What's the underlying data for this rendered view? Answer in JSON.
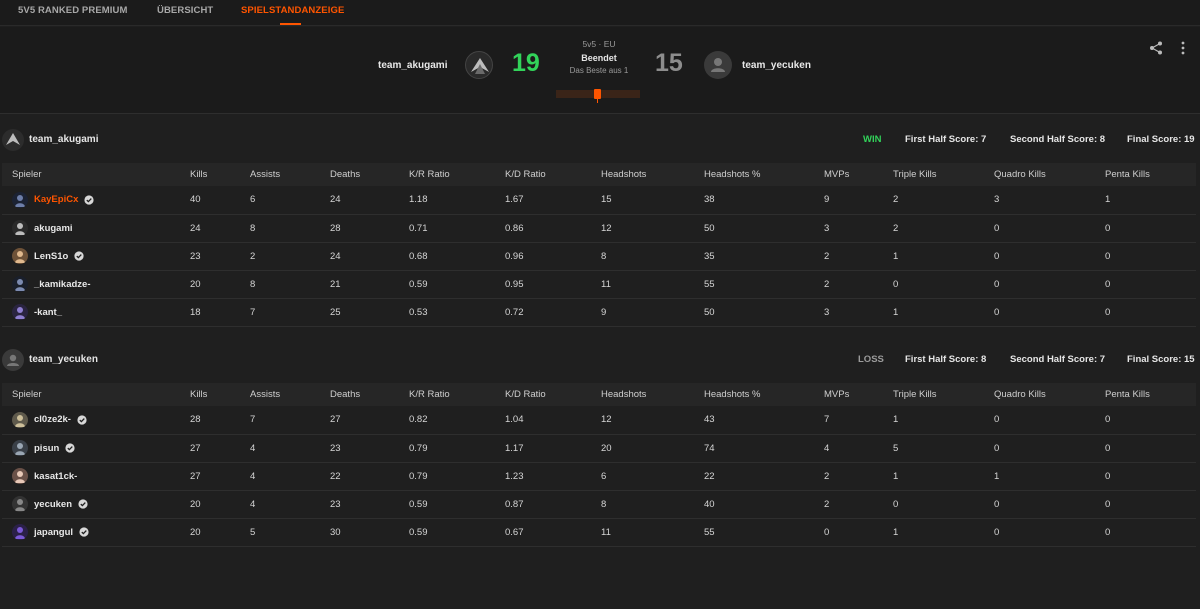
{
  "nav": {
    "tabs": [
      {
        "label": "5V5 RANKED PREMIUM"
      },
      {
        "label": "ÜBERSICHT"
      },
      {
        "label": "SPIELSTANDANZEIGE"
      }
    ]
  },
  "match": {
    "mode": "5v5 · EU",
    "status": "Beendet",
    "best_of": "Das Beste aus 1",
    "team1": {
      "name": "team_akugami",
      "score": "19"
    },
    "team2": {
      "name": "team_yecuken",
      "score": "15"
    }
  },
  "icons": {
    "share": "share-icon",
    "more": "more-vertical-icon",
    "verified": "verified-check-icon"
  },
  "colors": {
    "accent": "#ff5500",
    "win": "#32d35a",
    "loss_score": "#8d8d8d"
  },
  "columns": [
    "Spieler",
    "Kills",
    "Assists",
    "Deaths",
    "K/R Ratio",
    "K/D Ratio",
    "Headshots",
    "Headshots %",
    "MVPs",
    "Triple Kills",
    "Quadro Kills",
    "Penta Kills"
  ],
  "teams": [
    {
      "name": "team_akugami",
      "result": "WIN",
      "first_half": "First Half Score: 7",
      "second_half": "Second Half Score: 8",
      "final": "Final Score: 19",
      "players": [
        {
          "name": "KayEpiCx",
          "verified": true,
          "highlight": true,
          "stats": [
            "40",
            "6",
            "24",
            "1.18",
            "1.67",
            "15",
            "38",
            "9",
            "2",
            "3",
            "1"
          ]
        },
        {
          "name": "akugami",
          "verified": false,
          "highlight": false,
          "stats": [
            "24",
            "8",
            "28",
            "0.71",
            "0.86",
            "12",
            "50",
            "3",
            "2",
            "0",
            "0"
          ]
        },
        {
          "name": "LenS1o",
          "verified": true,
          "highlight": false,
          "stats": [
            "23",
            "2",
            "24",
            "0.68",
            "0.96",
            "8",
            "35",
            "2",
            "1",
            "0",
            "0"
          ]
        },
        {
          "name": "_kamikadze-",
          "verified": false,
          "highlight": false,
          "stats": [
            "20",
            "8",
            "21",
            "0.59",
            "0.95",
            "11",
            "55",
            "2",
            "0",
            "0",
            "0"
          ]
        },
        {
          "name": "-kant_",
          "verified": false,
          "highlight": false,
          "stats": [
            "18",
            "7",
            "25",
            "0.53",
            "0.72",
            "9",
            "50",
            "3",
            "1",
            "0",
            "0"
          ]
        }
      ]
    },
    {
      "name": "team_yecuken",
      "result": "LOSS",
      "first_half": "First Half Score: 8",
      "second_half": "Second Half Score: 7",
      "final": "Final Score: 15",
      "players": [
        {
          "name": "cl0ze2k-",
          "verified": true,
          "highlight": false,
          "stats": [
            "28",
            "7",
            "27",
            "0.82",
            "1.04",
            "12",
            "43",
            "7",
            "1",
            "0",
            "0"
          ]
        },
        {
          "name": "pisun",
          "verified": true,
          "highlight": false,
          "stats": [
            "27",
            "4",
            "23",
            "0.79",
            "1.17",
            "20",
            "74",
            "4",
            "5",
            "0",
            "0"
          ]
        },
        {
          "name": "kasat1ck-",
          "verified": false,
          "highlight": false,
          "stats": [
            "27",
            "4",
            "22",
            "0.79",
            "1.23",
            "6",
            "22",
            "2",
            "1",
            "1",
            "0"
          ]
        },
        {
          "name": "yecuken",
          "verified": true,
          "highlight": false,
          "stats": [
            "20",
            "4",
            "23",
            "0.59",
            "0.87",
            "8",
            "40",
            "2",
            "0",
            "0",
            "0"
          ]
        },
        {
          "name": "japangul",
          "verified": true,
          "highlight": false,
          "stats": [
            "20",
            "5",
            "30",
            "0.59",
            "0.67",
            "11",
            "55",
            "0",
            "1",
            "0",
            "0"
          ]
        }
      ]
    }
  ]
}
